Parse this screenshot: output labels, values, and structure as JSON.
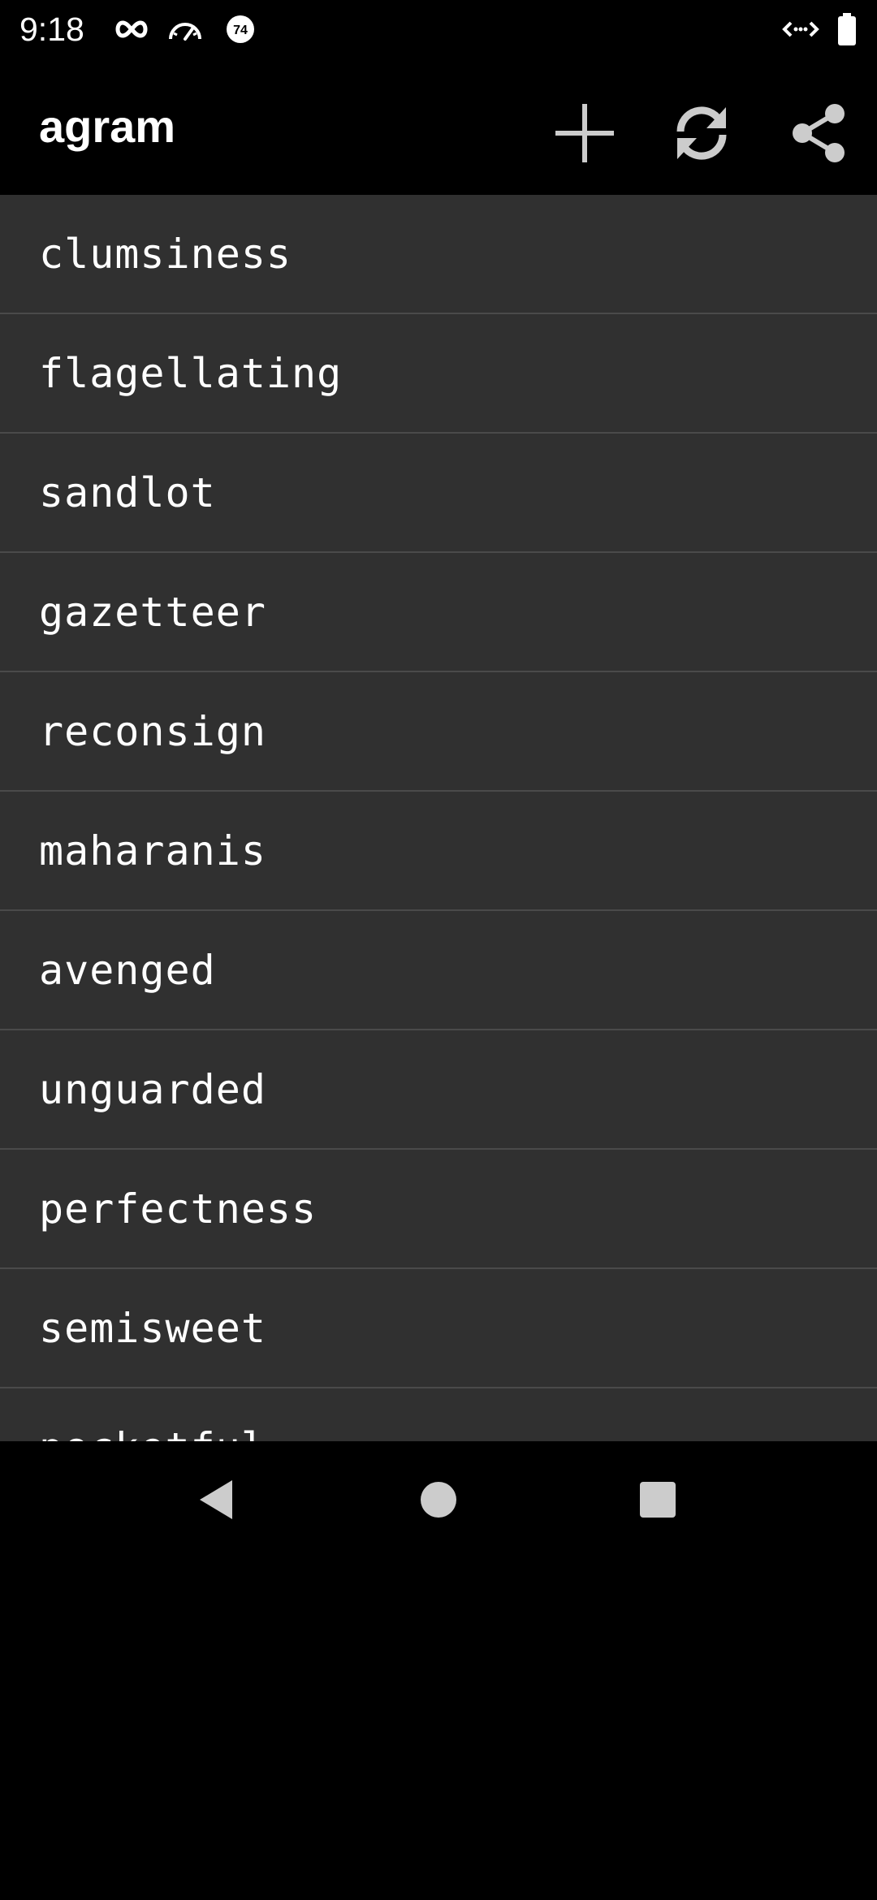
{
  "status_bar": {
    "time": "9:18",
    "icons": [
      "infinity-icon",
      "speedometer-icon",
      "notification-74-icon",
      "data-transfer-icon",
      "battery-icon"
    ],
    "badge_number": "74"
  },
  "app_bar": {
    "title": "agram",
    "actions": [
      "add-icon",
      "refresh-icon",
      "share-icon"
    ]
  },
  "word_list": {
    "items": [
      "clumsiness",
      "flagellating",
      "sandlot",
      "gazetteer",
      "reconsign",
      "maharanis",
      "avenged",
      "unguarded",
      "perfectness",
      "semisweet",
      "pocketful"
    ]
  },
  "nav_bar": {
    "buttons": [
      "back-icon",
      "home-icon",
      "recents-icon"
    ]
  },
  "colors": {
    "background": "#000000",
    "list_background": "#303030",
    "divider": "#4a4a4a",
    "text": "#ffffff",
    "icon": "#cccccc"
  }
}
